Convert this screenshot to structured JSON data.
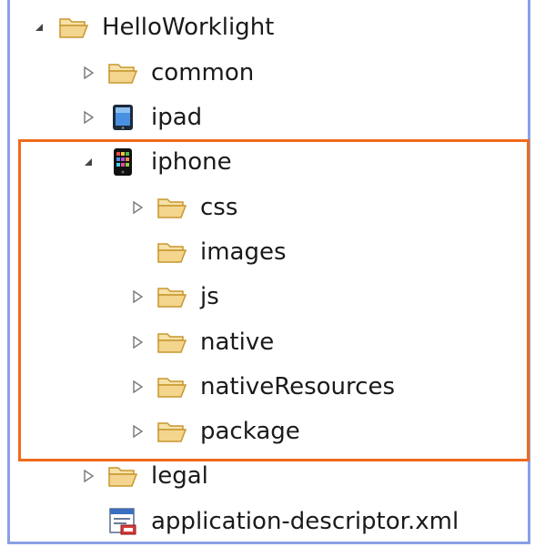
{
  "tree": {
    "root": {
      "label": "HelloWorklight",
      "icon": "folder-open-icon",
      "expanded": true
    },
    "common": {
      "label": "common",
      "icon": "folder-open-icon",
      "expanded": false
    },
    "ipad": {
      "label": "ipad",
      "icon": "ipad-icon",
      "expanded": false
    },
    "iphone": {
      "label": "iphone",
      "icon": "iphone-icon",
      "expanded": true,
      "children": [
        {
          "label": "css",
          "icon": "folder-open-icon",
          "expanded": false
        },
        {
          "label": "images",
          "icon": "folder-open-icon"
        },
        {
          "label": "js",
          "icon": "folder-open-icon",
          "expanded": false
        },
        {
          "label": "native",
          "icon": "folder-open-icon",
          "expanded": false
        },
        {
          "label": "nativeResources",
          "icon": "folder-open-icon",
          "expanded": false
        },
        {
          "label": "package",
          "icon": "folder-open-icon",
          "expanded": false
        }
      ]
    },
    "legal": {
      "label": "legal",
      "icon": "folder-open-icon",
      "expanded": false
    },
    "descriptor": {
      "label": "application-descriptor.xml",
      "icon": "xml-descriptor-file-icon"
    }
  },
  "colors": {
    "frame_border": "#8aa0e6",
    "highlight_border": "#f06a1c",
    "folder_fill": "#f3d58e",
    "folder_stroke": "#c8962e"
  }
}
